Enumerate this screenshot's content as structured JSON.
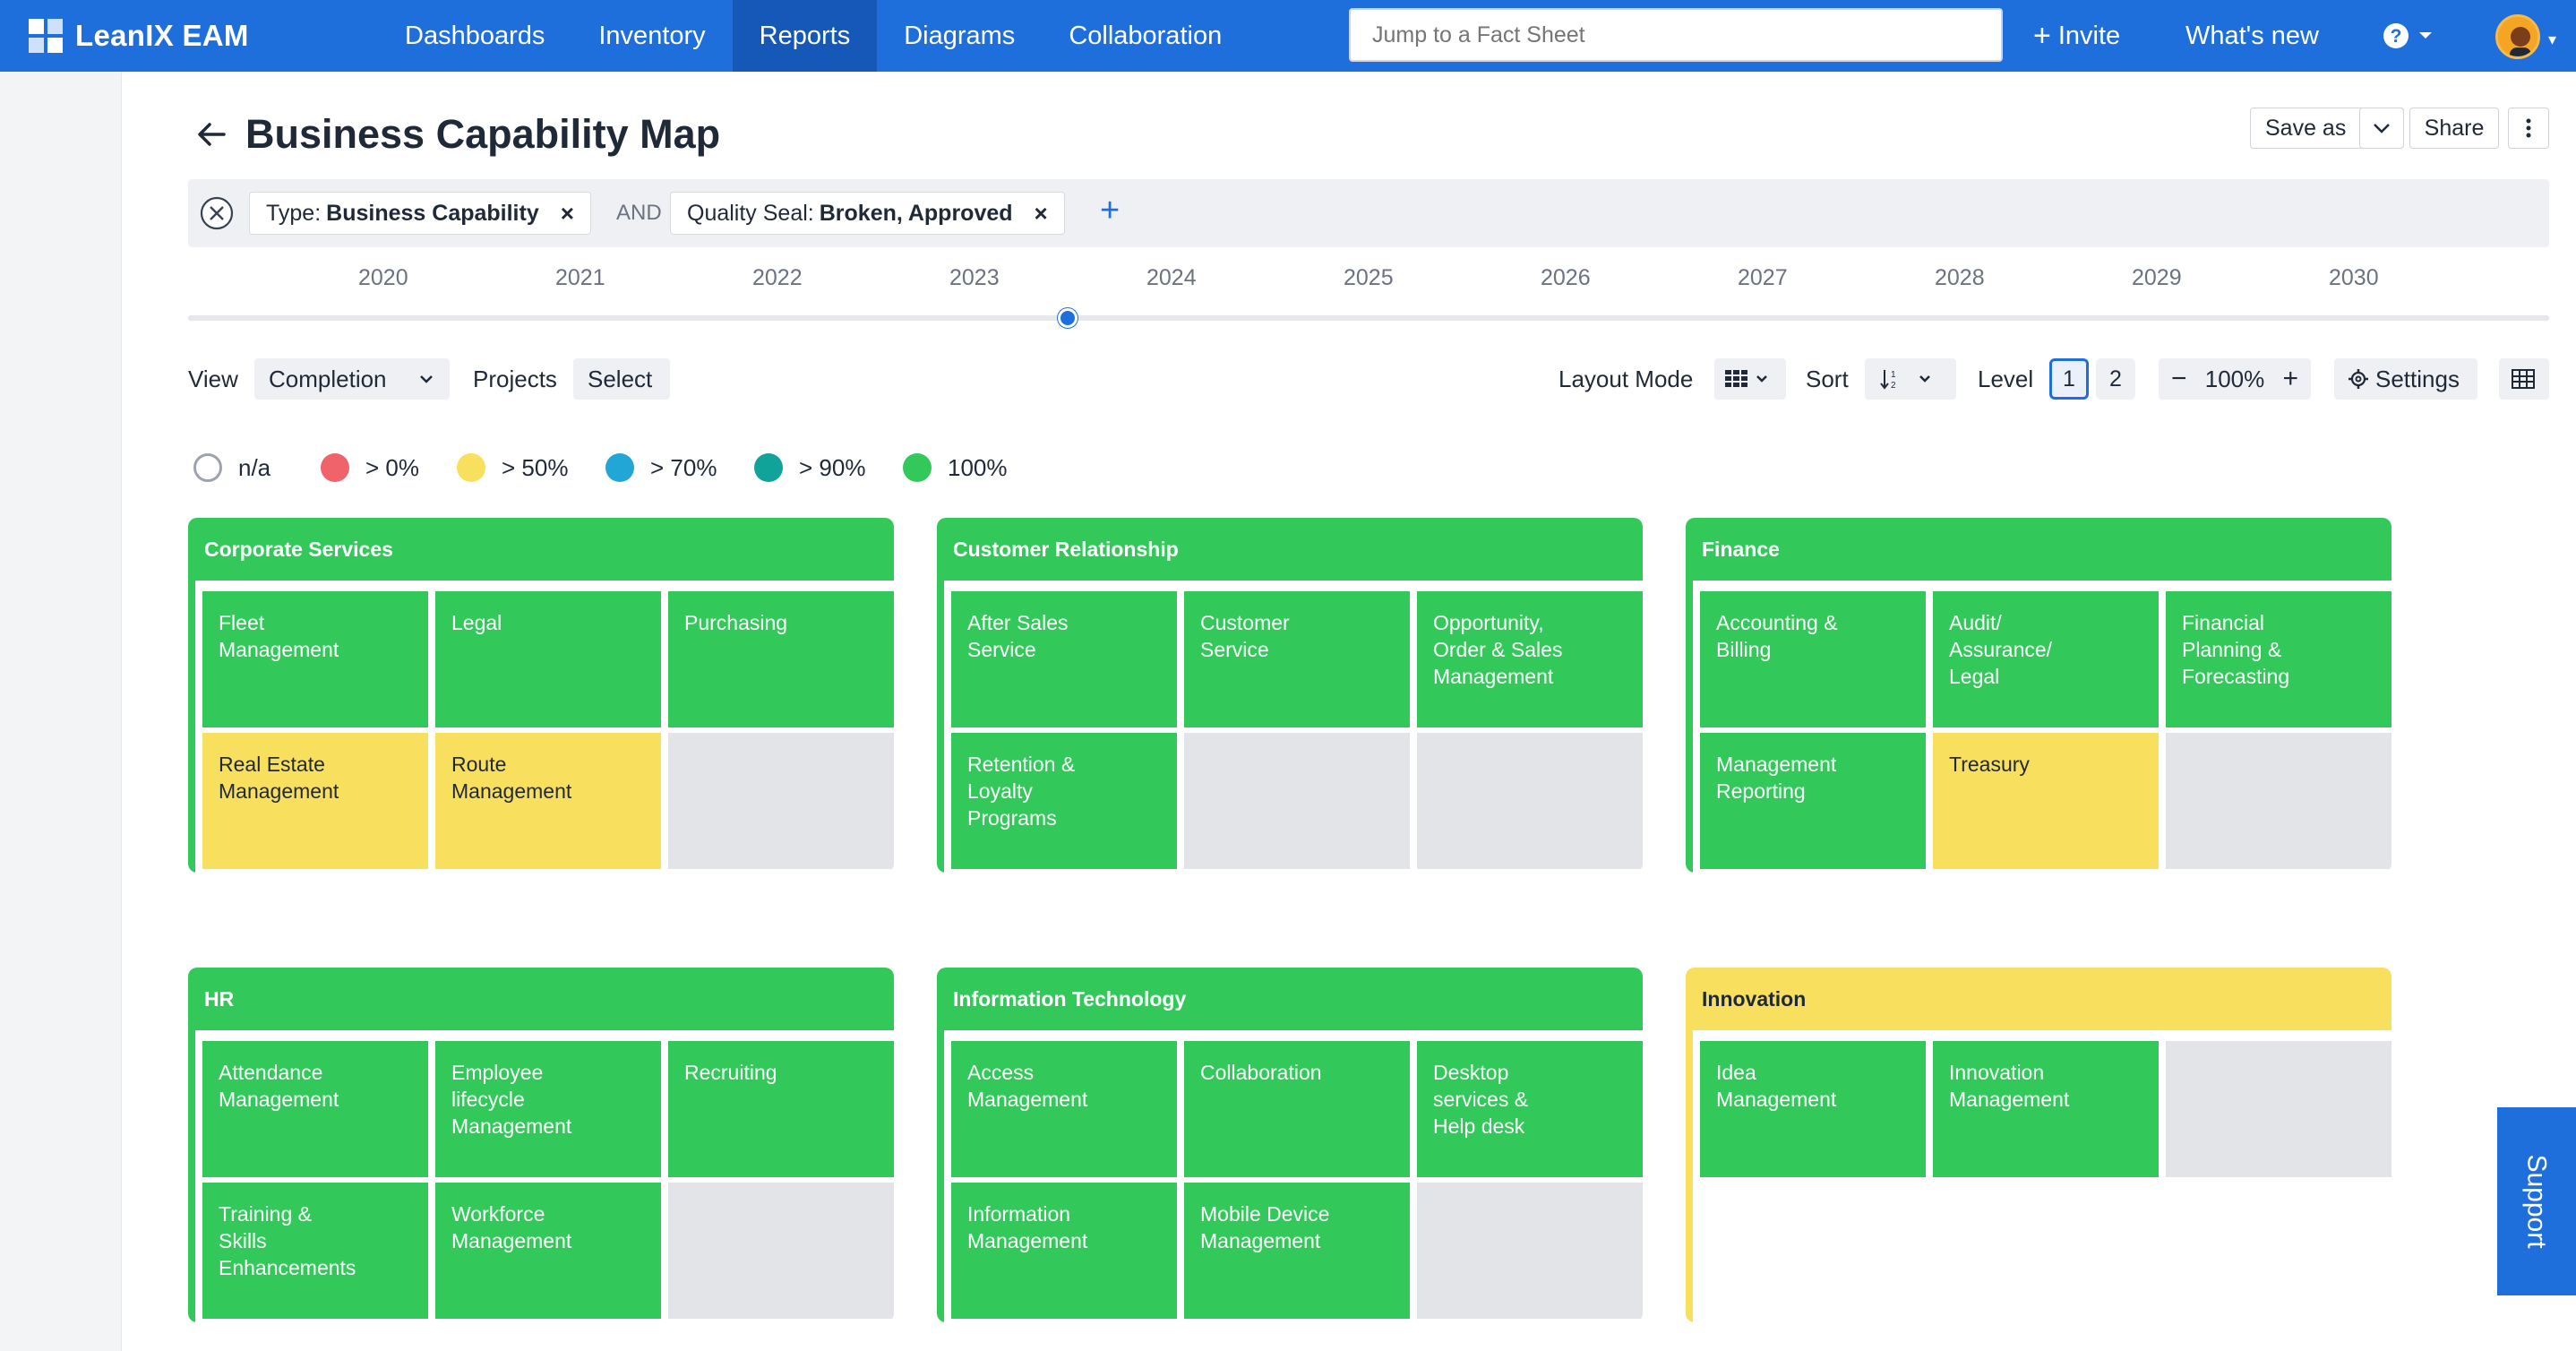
{
  "app": {
    "name": "LeanIX EAM"
  },
  "nav": {
    "items": [
      "Dashboards",
      "Inventory",
      "Reports",
      "Diagrams",
      "Collaboration"
    ],
    "active": "Reports"
  },
  "search": {
    "placeholder": "Jump to a Fact Sheet"
  },
  "topbar": {
    "invite": "Invite",
    "whats_new": "What's new",
    "help_icon": "question-icon"
  },
  "page": {
    "title": "Business Capability Map",
    "save_as": "Save as",
    "share": "Share"
  },
  "filters": {
    "chips": [
      {
        "key": "Type:",
        "value": "Business Capability"
      },
      {
        "key": "Quality Seal:",
        "value": "Broken, Approved"
      }
    ],
    "joiner": "AND"
  },
  "timeline": {
    "years": [
      "2020",
      "2021",
      "2022",
      "2023",
      "2024",
      "2025",
      "2026",
      "2027",
      "2028",
      "2029",
      "2030"
    ],
    "current_position": 0.373
  },
  "controls": {
    "view_label": "View",
    "view_value": "Completion",
    "projects_label": "Projects",
    "projects_value": "Select",
    "layout_label": "Layout Mode",
    "sort_label": "Sort",
    "level_label": "Level",
    "levels": [
      "1",
      "2"
    ],
    "active_level": "1",
    "zoom": "100%",
    "settings": "Settings"
  },
  "legend": [
    {
      "label": "n/a",
      "color": "#ffffff"
    },
    {
      "label": "> 0%",
      "color": "#f0636b"
    },
    {
      "label": "> 50%",
      "color": "#f9df5e"
    },
    {
      "label": "> 70%",
      "color": "#22a6d6"
    },
    {
      "label": "> 90%",
      "color": "#10a39a"
    },
    {
      "label": "100%",
      "color": "#33c95a"
    }
  ],
  "colors": {
    "accent": "#1e6fdb",
    "green": "#33c95a",
    "yellow": "#f9df5e",
    "empty": "#e2e4e8"
  },
  "groups": [
    {
      "name": "Corporate Services",
      "status": "green",
      "cells": [
        {
          "label": "Fleet\nManagement",
          "status": "green"
        },
        {
          "label": "Legal",
          "status": "green"
        },
        {
          "label": "Purchasing",
          "status": "green"
        },
        {
          "label": "Real Estate\nManagement",
          "status": "yellow"
        },
        {
          "label": "Route\nManagement",
          "status": "yellow"
        },
        {
          "label": "",
          "status": "gray"
        }
      ]
    },
    {
      "name": "Customer Relationship",
      "status": "green",
      "cells": [
        {
          "label": "After Sales\nService",
          "status": "green"
        },
        {
          "label": "Customer\nService",
          "status": "green"
        },
        {
          "label": "Opportunity,\nOrder & Sales\nManagement",
          "status": "green"
        },
        {
          "label": "Retention &\nLoyalty\nPrograms",
          "status": "green"
        },
        {
          "label": "",
          "status": "gray"
        },
        {
          "label": "",
          "status": "gray"
        }
      ]
    },
    {
      "name": "Finance",
      "status": "green",
      "cells": [
        {
          "label": "Accounting &\nBilling",
          "status": "green"
        },
        {
          "label": "Audit/\nAssurance/\nLegal",
          "status": "green"
        },
        {
          "label": "Financial\nPlanning &\nForecasting",
          "status": "green"
        },
        {
          "label": "Management\nReporting",
          "status": "green"
        },
        {
          "label": "Treasury",
          "status": "yellow"
        },
        {
          "label": "",
          "status": "gray"
        }
      ]
    },
    {
      "name": "HR",
      "status": "green",
      "cells": [
        {
          "label": "Attendance\nManagement",
          "status": "green"
        },
        {
          "label": "Employee\nlifecycle\nManagement",
          "status": "green"
        },
        {
          "label": "Recruiting",
          "status": "green"
        },
        {
          "label": "Training &\nSkills\nEnhancements",
          "status": "green"
        },
        {
          "label": "Workforce\nManagement",
          "status": "green"
        },
        {
          "label": "",
          "status": "gray"
        }
      ]
    },
    {
      "name": "Information Technology",
      "status": "green",
      "cells": [
        {
          "label": "Access\nManagement",
          "status": "green"
        },
        {
          "label": "Collaboration",
          "status": "green"
        },
        {
          "label": "Desktop\nservices &\nHelp desk",
          "status": "green"
        },
        {
          "label": "Information\nManagement",
          "status": "green"
        },
        {
          "label": "Mobile Device\nManagement",
          "status": "green"
        },
        {
          "label": "",
          "status": "gray"
        }
      ]
    },
    {
      "name": "Innovation",
      "status": "yellow",
      "cells": [
        {
          "label": "Idea\nManagement",
          "status": "green"
        },
        {
          "label": "Innovation\nManagement",
          "status": "green"
        },
        {
          "label": "",
          "status": "gray"
        }
      ]
    }
  ],
  "support": {
    "label": "Support"
  }
}
